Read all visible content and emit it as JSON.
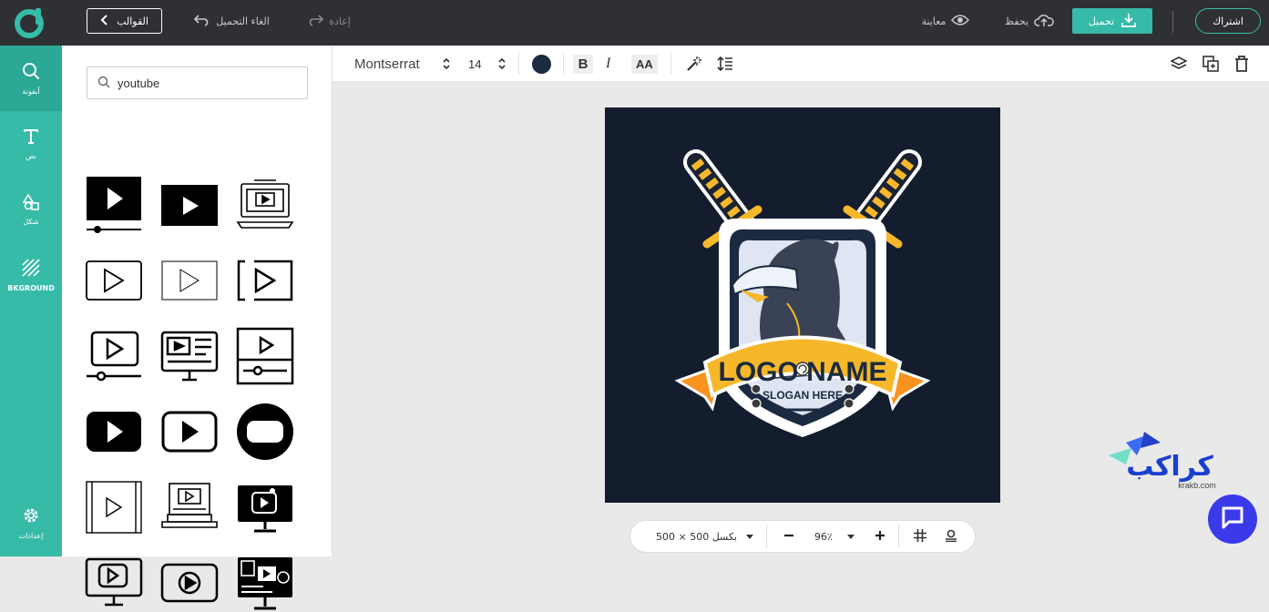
{
  "topbar": {
    "templates_label": "القوالب",
    "undo_label": "الغاء التحميل",
    "redo_label": "إعادة",
    "preview_label": "معاينة",
    "save_label": "يحفظ",
    "download_label": "تحميل",
    "subscribe_label": "اشتراك"
  },
  "sidebar": {
    "items": [
      {
        "label": "أيقونة",
        "icon": "search-icon"
      },
      {
        "label": "نص",
        "icon": "text-icon"
      },
      {
        "label": "شكل",
        "icon": "shapes-icon"
      },
      {
        "label": "BKGROUND",
        "icon": "background-icon"
      },
      {
        "label": "إعدادات",
        "icon": "gear-icon"
      }
    ]
  },
  "search": {
    "value": "youtube"
  },
  "toolbar": {
    "font_family": "Montserrat",
    "font_size": "14",
    "text_color": "#1b2a40",
    "bold": "B",
    "italic": "I",
    "case": "AA"
  },
  "canvas": {
    "background": "#131d2e",
    "logo_name": "LOGO NAME",
    "slogan": "SLOGAN HERE"
  },
  "zoom": {
    "size_label": "500 × 500 بكسل",
    "zoom_value": "96٪"
  },
  "watermark": {
    "name": "كراكب",
    "url": "krakb.com"
  },
  "colors": {
    "accent": "#36bba8",
    "topbar": "#2f3033",
    "chat": "#3a3aeb"
  }
}
